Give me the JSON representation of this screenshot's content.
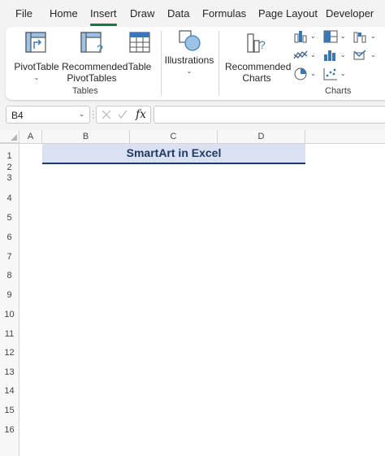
{
  "menu": {
    "items": [
      "File",
      "Home",
      "Insert",
      "Draw",
      "Data",
      "Formulas",
      "Page Layout",
      "Developer"
    ],
    "active": "Insert",
    "accent_color": "#107c41"
  },
  "ribbon": {
    "tables_group": {
      "label": "Tables",
      "pivottable": "PivotTable",
      "recommended_pivottables_line1": "Recommended",
      "recommended_pivottables_line2": "PivotTables",
      "table": "Table"
    },
    "illustrations": {
      "label": "Illustrations"
    },
    "charts_group": {
      "label": "Charts",
      "recommended_charts_line1": "Recommended",
      "recommended_charts_line2": "Charts"
    }
  },
  "formula_bar": {
    "name_box": "B4",
    "fx": "fx",
    "formula": ""
  },
  "sheet": {
    "columns": [
      "A",
      "B",
      "C",
      "D"
    ],
    "rows": [
      "1",
      "2",
      "3",
      "4",
      "5",
      "6",
      "7",
      "8",
      "9",
      "10",
      "11",
      "12",
      "13",
      "14",
      "15",
      "16"
    ],
    "title_cell_text": "SmartArt in Excel",
    "title_fill": "#d9e1f2",
    "title_color": "#1f3864"
  }
}
